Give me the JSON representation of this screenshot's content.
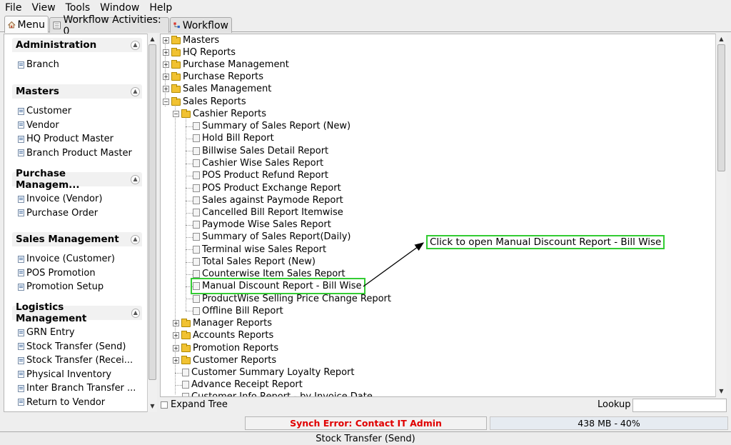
{
  "menubar": {
    "items": [
      "File",
      "View",
      "Tools",
      "Window",
      "Help"
    ]
  },
  "tabs": [
    {
      "label": "Menu",
      "icon": "home-icon",
      "active": true
    },
    {
      "label": "Workflow Activities: 0",
      "icon": "list-icon",
      "active": false
    },
    {
      "label": "Workflow",
      "icon": "workflow-icon",
      "active": false
    }
  ],
  "sidebar": {
    "groups": [
      {
        "title": "Administration",
        "items": [
          "Branch"
        ]
      },
      {
        "title": "Masters",
        "items": [
          "Customer",
          "Vendor",
          "HQ Product Master",
          "Branch Product Master"
        ]
      },
      {
        "title": "Purchase Managem...",
        "items": [
          "Invoice (Vendor)",
          "Purchase Order"
        ]
      },
      {
        "title": "Sales Management",
        "items": [
          "Invoice (Customer)",
          "POS Promotion",
          "Promotion Setup"
        ]
      },
      {
        "title": "Logistics Management",
        "items": [
          "GRN Entry",
          "Stock Transfer (Send)",
          "Stock Transfer (Recei...",
          "Physical Inventory",
          "Inter Branch Transfer ...",
          "Return to Vendor"
        ]
      }
    ]
  },
  "tree": {
    "top": [
      "Masters",
      "HQ Reports",
      "Purchase Management",
      "Purchase Reports",
      "Sales Management",
      "Sales Reports"
    ],
    "cashier_folder": "Cashier Reports",
    "cashier_reports": [
      "Summary of Sales Report (New)",
      "Hold Bill Report",
      "Billwise Sales Detail Report",
      "Cashier Wise Sales Report",
      "POS Product Refund Report",
      "POS Product Exchange Report",
      "Sales against Paymode Report",
      "Cancelled Bill Report Itemwise",
      "Paymode Wise Sales Report",
      "Summary of Sales Report(Daily)",
      "Terminal wise Sales Report",
      "Total Sales Report (New)",
      "Counterwise Item Sales Report",
      "Manual Discount Report - Bill Wise",
      "ProductWise Selling Price Change Report",
      "Offline Bill Report"
    ],
    "sales_folders": [
      "Manager Reports",
      "Accounts Reports",
      "Promotion Reports",
      "Customer Reports"
    ],
    "sales_leaves": [
      "Customer Summary Loyalty Report",
      "Advance Receipt Report",
      "Customer Info Report - by Invoice Date"
    ]
  },
  "callout": {
    "text": "Click to open Manual Discount Report - Bill Wise"
  },
  "bottom": {
    "expand_tree_label": "Expand Tree",
    "lookup_label": "Lookup",
    "lookup_value": "",
    "synch_error": "Synch Error: Contact IT Admin",
    "memory": "438 MB - 40%",
    "status": "Stock Transfer (Send)"
  }
}
